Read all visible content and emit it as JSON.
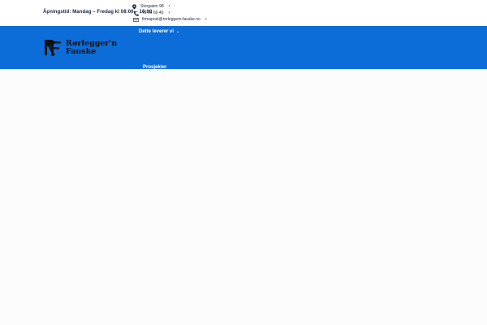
{
  "topbar": {
    "hours": "Åpningstid: Mandag – Fredag kl 08:00 – 16:00",
    "contacts": [
      {
        "icon": "location-pin-icon",
        "text": "Storgaten 98"
      },
      {
        "icon": "phone-icon",
        "text": "75 64 69 40"
      },
      {
        "icon": "mail-icon",
        "text": "firmapost@rorleggern-fauske.no"
      }
    ]
  },
  "header": {
    "logo": {
      "line1": "Rørlegger'n",
      "line2": "Fauske"
    },
    "nav": [
      {
        "label": "Dette leverer vi",
        "has_dropdown": true
      },
      {
        "label": "Prosjekter",
        "has_dropdown": false
      }
    ]
  },
  "colors": {
    "header_blue": "#0c6cd8",
    "text_dark": "#1a2340",
    "background": "#fcfcfc"
  }
}
